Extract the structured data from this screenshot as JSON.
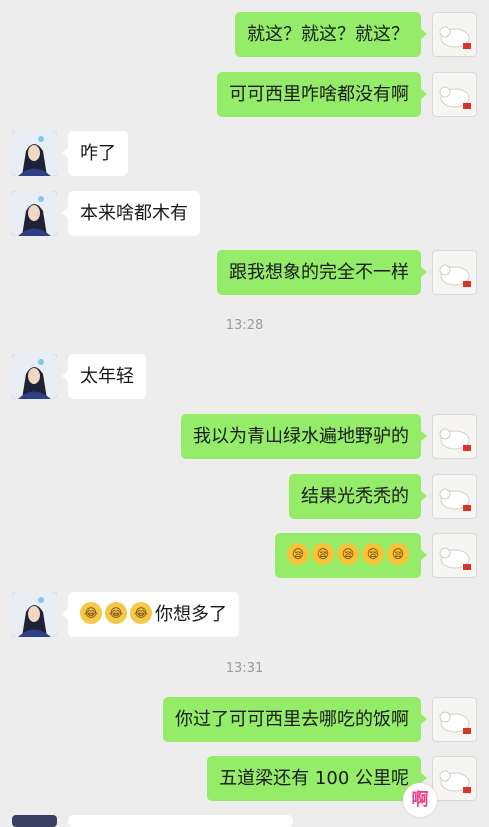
{
  "messages": [
    {
      "text": "就这？就这？就这？"
    },
    {
      "text": "可可西里咋啥都没有啊"
    },
    {
      "text": "咋了"
    },
    {
      "text": "本来啥都木有"
    },
    {
      "text": "跟我想象的完全不一样"
    },
    {
      "text": "太年轻"
    },
    {
      "text": "我以为青山绿水遍地野驴的"
    },
    {
      "text": "结果光秃秃的"
    },
    {
      "emoji_count": 5,
      "emoji": "sleepy-face"
    },
    {
      "text": "你想多了",
      "emoji_count": 3,
      "emoji": "crying-laughing-face"
    },
    {
      "text": "你过了可可西里去哪吃的饭啊"
    },
    {
      "text": "五道梁还有 100 公里呢"
    }
  ],
  "timestamps": [
    "13:28",
    "13:31"
  ],
  "watermark_text": "啊"
}
